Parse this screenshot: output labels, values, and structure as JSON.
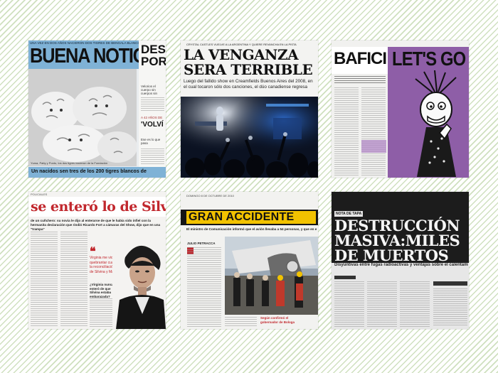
{
  "clip1": {
    "topline": "UNA VEZ EN DOS AÑOS NACIERON DOS TIGRES DE BENGALA BLANCOS",
    "headline": "BUENA NOTICIA",
    "side_headline": "DES POR",
    "side_text": "Velorios el cuerpo sin cuerpos sin",
    "side_kicker": "A 42 AÑOS DE",
    "side_quote": "'VOLVÍ",
    "side_text2": "Ese es lo que pasa",
    "caption": "Yuma, Patty y Ponto, los dos tigres nacieron de la Fundación",
    "footer": "Un nacidos sen tres de los 200 tigres blancos de"
  },
  "clip2": {
    "kicker": "CRYSTAL CASTLES VUELVE A LA ARGENTINA Y QUIERE REVANCHA EN LA PISTA",
    "headline_line1": "LA VENGANZA",
    "headline_line2": "SERA TERRIBLE",
    "deck": "Luego del fallido show en Creamfields Buenos Aires del 2008, en el cual tocaron sólo dos canciones, el dúo canadiense regresa"
  },
  "clip3": {
    "headline_left": "BAFICI",
    "headline_right": "LET'S GO"
  },
  "clip4": {
    "section": "POLICIALES",
    "headline": "se enteró lo de Silvi",
    "lede": "de un cuñchero: su novia le dijo al enterarse de que le había sido infiel con la hermanita declaración que rindió Ricardo Fort a cámaras del Show, dijo que en una \"trampa\"",
    "quote": "Virginia me vio quebrantar cuanto la reconciliación de Silvina y Matías",
    "question": "¿Virginia nunca se enteró de que Silvina estaba embarazada?"
  },
  "clip5": {
    "date": "DOMINGO 8 DE OCTUBRE DE 2010",
    "headline": "GRAN ACCIDENTE",
    "deck": "El ministro de Comunicación informó que el avión llevaba a 54 personas, y que en este mo",
    "byline": "JULIO PETRACCA",
    "caption": "Según confirmó el gobernador de Bologa"
  },
  "clip6": {
    "kicker": "NOTA DE TAPA",
    "headline_line1": "DESTRUCCIÓN",
    "headline_line2": "MASIVA:MILES",
    "headline_line3": "DE MUERTOS",
    "deck": "Disyuntivas entre fugas radioactivas y ventajas sobre el calentamiento global quedan obsoletas frente a la pérdida de miles de vidas"
  }
}
